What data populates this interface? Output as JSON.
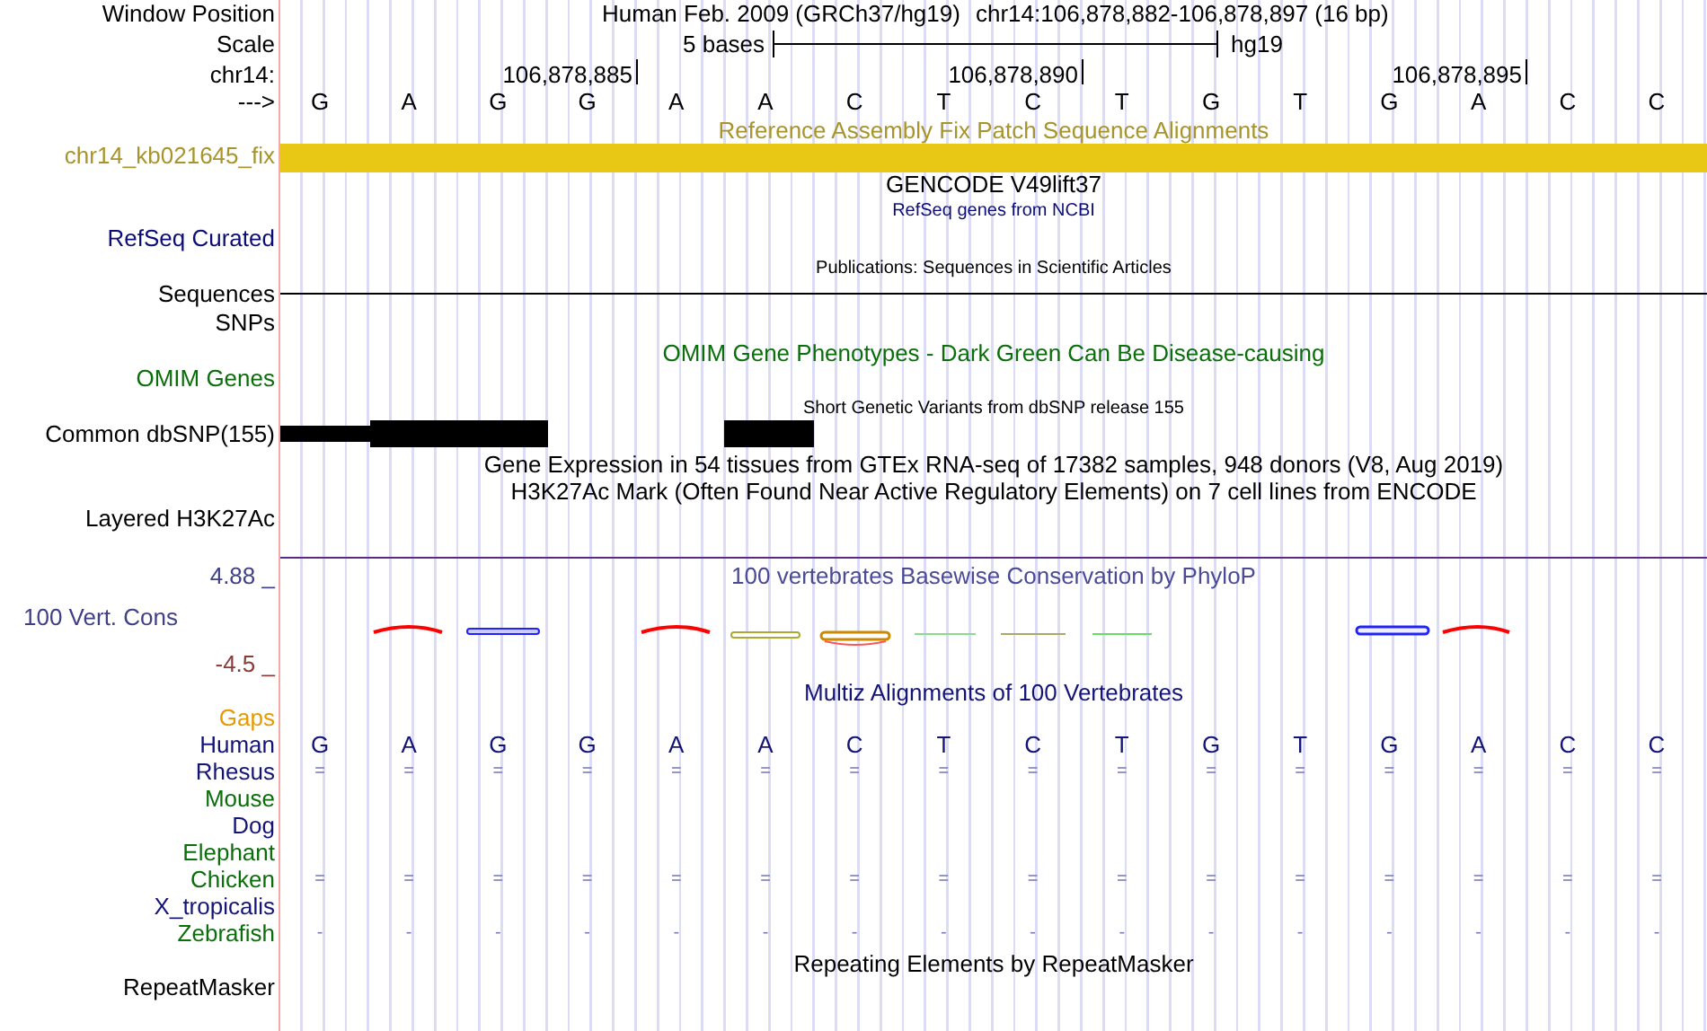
{
  "header": {
    "label": "Window Position",
    "assembly": "Human Feb. 2009 (GRCh37/hg19)",
    "position": "chr14:106,878,882-106,878,897 (16 bp)"
  },
  "scale": {
    "label": "Scale",
    "bar_label": "5 bases",
    "assembly": "hg19"
  },
  "ruler": {
    "label": "chr14:",
    "ticks": [
      "106,878,885",
      "106,878,890",
      "106,878,895"
    ]
  },
  "sequence": {
    "label": "--->",
    "bases": [
      "G",
      "A",
      "G",
      "G",
      "A",
      "A",
      "C",
      "T",
      "C",
      "T",
      "G",
      "T",
      "G",
      "A",
      "C",
      "C"
    ]
  },
  "tracks": [
    {
      "kind": "patch",
      "title": "Reference Assembly Fix Patch Sequence Alignments",
      "label": "chr14_kb021645_fix",
      "color": "#a8942a"
    },
    {
      "kind": "title",
      "title": "GENCODE V49lift37",
      "color": "#000000"
    },
    {
      "kind": "plain",
      "title": "RefSeq genes from NCBI",
      "label": "RefSeq Curated",
      "color": "#0c0c78"
    },
    {
      "kind": "line",
      "title": "Publications: Sequences in Scientific Articles",
      "label": "Sequences",
      "color": "#000000"
    },
    {
      "kind": "label",
      "label": "SNPs",
      "color": "#000000"
    },
    {
      "kind": "plain",
      "title": "OMIM Gene Phenotypes - Dark Green Can Be Disease-causing",
      "label": "OMIM Genes",
      "color": "#0a6e0a"
    },
    {
      "kind": "snp",
      "title": "Short Genetic Variants from dbSNP release 155",
      "label": "Common dbSNP(155)",
      "color": "#000000"
    },
    {
      "kind": "title",
      "title": "Gene Expression in 54 tissues from GTEx RNA-seq of 17382 samples, 948 donors (V8, Aug 2019)",
      "color": "#000000"
    },
    {
      "kind": "plain",
      "title": "H3K27Ac Mark (Often Found Near Active Regulatory Elements) on 7 cell lines from ENCODE",
      "label": "Layered H3K27Ac",
      "color": "#000000"
    }
  ],
  "conservation": {
    "title": "100 vertebrates Basewise Conservation by PhyloP",
    "label": "100 Vert. Cons",
    "max": "4.88 _",
    "min": "-4.5 _"
  },
  "multiz": {
    "title": "Multiz Alignments of 100 Vertebrates",
    "gaps_label": "Gaps",
    "species": [
      {
        "name": "Human",
        "color": "#141478",
        "cells": [
          "G",
          "A",
          "G",
          "G",
          "A",
          "A",
          "C",
          "T",
          "C",
          "T",
          "G",
          "T",
          "G",
          "A",
          "C",
          "C"
        ]
      },
      {
        "name": "Rhesus",
        "color": "#141478",
        "cells": [
          "=",
          "=",
          "=",
          "=",
          "=",
          "=",
          "=",
          "=",
          "=",
          "=",
          "=",
          "=",
          "=",
          "=",
          "=",
          "="
        ]
      },
      {
        "name": "Mouse",
        "color": "#0a6e0a"
      },
      {
        "name": "Dog",
        "color": "#141478"
      },
      {
        "name": "Elephant",
        "color": "#0a6e0a"
      },
      {
        "name": "Chicken",
        "color": "#0a6e0a",
        "cells": [
          "=",
          "=",
          "=",
          "=",
          "=",
          "=",
          "=",
          "=",
          "=",
          "=",
          "=",
          "=",
          "=",
          "=",
          "=",
          "="
        ]
      },
      {
        "name": "X_tropicalis",
        "color": "#141478"
      },
      {
        "name": "Zebrafish",
        "color": "#0a6e0a",
        "cells": [
          "-",
          "-",
          "-",
          "-",
          "-",
          "-",
          "-",
          "-",
          "-",
          "-",
          "-",
          "-",
          "-",
          "-",
          "-",
          "-"
        ]
      }
    ]
  },
  "repeats": {
    "title": "Repeating Elements by RepeatMasker",
    "label": "RepeatMasker"
  }
}
